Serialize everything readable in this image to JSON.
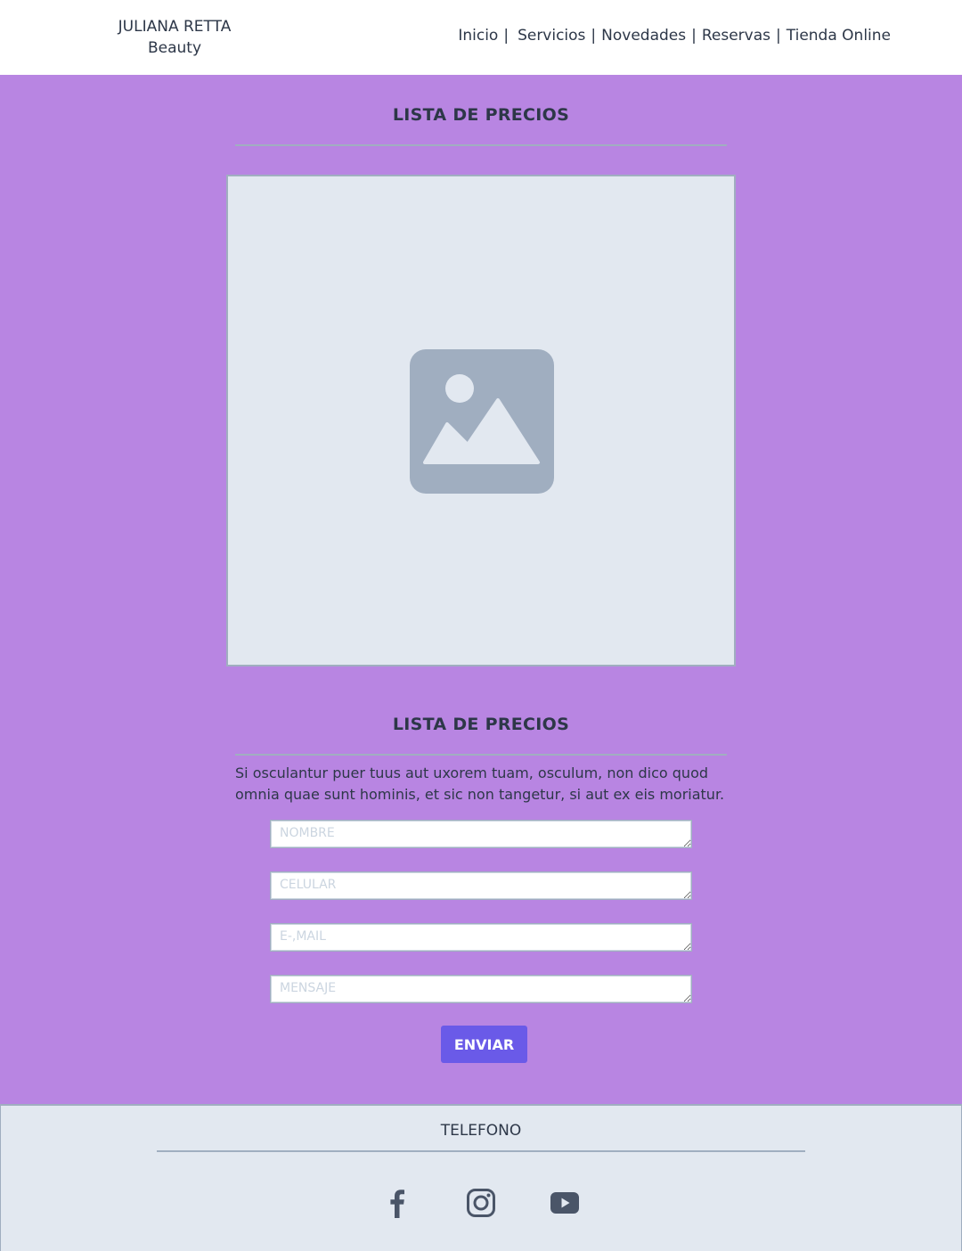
{
  "header": {
    "brand_line1": "JULIANA RETTA",
    "brand_line2": "Beauty",
    "nav": [
      {
        "label": "Inicio"
      },
      {
        "label": "Servicios"
      },
      {
        "label": "Novedades"
      },
      {
        "label": "Reservas"
      },
      {
        "label": "Tienda Online"
      }
    ],
    "separator": "|"
  },
  "price_section": {
    "title": "LISTA DE PRECIOS",
    "image_icon": "image-placeholder-icon"
  },
  "contact_section": {
    "title": "LISTA DE PRECIOS",
    "description": "Si osculantur puer tuus aut uxorem tuam, osculum, non dico quod omnia quae sunt hominis, et sic non tangetur, si aut ex eis moriatur.",
    "fields": {
      "name_placeholder": "NOMBRE",
      "phone_placeholder": "CELULAR",
      "email_placeholder": "E-,MAIL",
      "message_placeholder": "MENSAJE"
    },
    "submit_label": "ENVIAR"
  },
  "footer": {
    "title": "TELEFONO",
    "social": [
      "facebook-icon",
      "instagram-icon",
      "youtube-icon"
    ]
  },
  "colors": {
    "background": "#b885e2",
    "header_bg": "#ffffff",
    "footer_bg": "#e2e8f0",
    "button": "#6a5ae8",
    "text": "#2d3748",
    "icon": "#4a5568"
  }
}
